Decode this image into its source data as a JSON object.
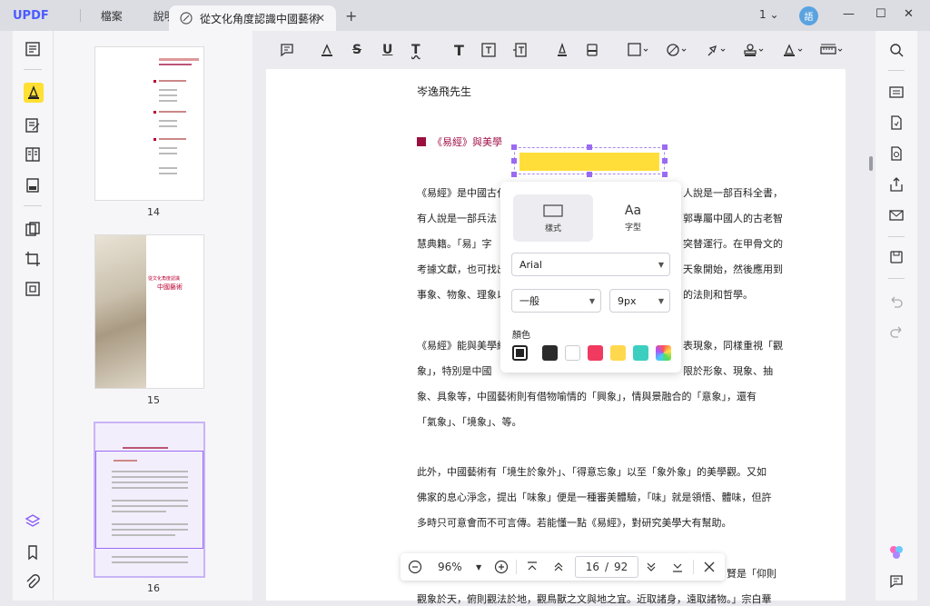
{
  "app": {
    "logo": "UPDF"
  },
  "menu": {
    "file": "檔案",
    "help": "說明"
  },
  "tab": {
    "title": "從文化角度認識中國藝術",
    "close": "✕",
    "new": "+"
  },
  "window": {
    "page_select": "1",
    "minimize": "—",
    "maximize": "☐",
    "close": "✕",
    "avatar": "語"
  },
  "thumbnails": [
    {
      "page": "14"
    },
    {
      "page": "15"
    },
    {
      "page": "16"
    }
  ],
  "thumb_texts": {
    "t15_title1": "從文化角度認識",
    "t15_title2": "中國藝術"
  },
  "doc": {
    "author": "岑逸飛先生",
    "heading": "《易經》與美學",
    "p1": [
      "《易經》是中國古代",
      "人說是一部百科全書，",
      "有人說是一部兵法",
      "郭專屬中國人的古老智",
      "慧典籍。「易」字",
      "突替運行。在甲骨文的",
      "考據文獻，也可找出",
      "天象開始，然後應用到",
      "事象、物象、理象以",
      "的法則和哲學。"
    ],
    "p2": [
      "《易經》能與美學結",
      "表現象，同樣重視「觀",
      "象」，特別是中國",
      "限於形象、現象、抽",
      "象、具象等，中國藝術則有借物喻情的「興象」，情與景融合的「意象」，還有",
      "「氣象」、「境象」、等。"
    ],
    "p3": [
      "此外，中國藝術有「境生於象外」、「得意忘象」以至「象外象」的美學觀。又如",
      "佛家的息心淨念，提出「味象」便是一種審美體驗，「味」就是領悟、體味，但許",
      "多時只可意會而不可言傳。若能懂一點《易經》，對研究美學大有幫助。"
    ],
    "p4_right": "賢是「仰則",
    "p4_bottom": "觀象於天，俯則觀法於地，觀鳥獸之文與地之宜。近取諸身，遠取諸物。」宗白華"
  },
  "popup": {
    "tab_style": "樣式",
    "tab_font_icon": "Aa",
    "tab_font": "字型",
    "font_family": "Arial",
    "font_weight": "一般",
    "font_size": "9px",
    "color_label": "顏色",
    "colors": [
      "#222222",
      "#2b2b2b",
      "#ffffff",
      "#f03a5f",
      "#ffd84d",
      "#3ccfc0",
      "#e85df0"
    ]
  },
  "pagenav": {
    "zoom": "96%",
    "current": "16",
    "separator": "/",
    "total": "92"
  }
}
